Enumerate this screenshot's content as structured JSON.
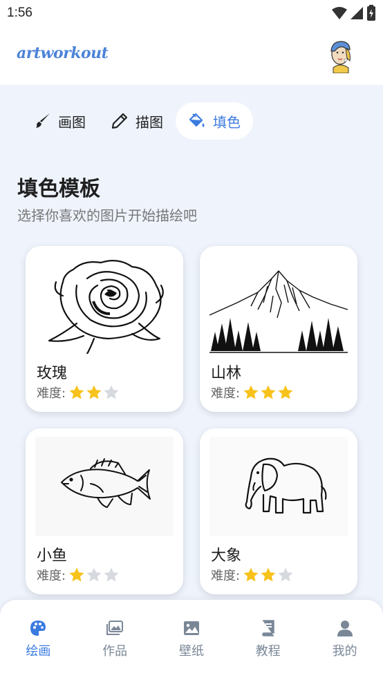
{
  "status_bar": {
    "time": "1:56"
  },
  "header": {
    "logo": "artworkout"
  },
  "mode_tabs": [
    {
      "label": "画图",
      "icon": "paintbrush-icon"
    },
    {
      "label": "描图",
      "icon": "pencil-icon"
    },
    {
      "label": "填色",
      "icon": "paint-bucket-icon",
      "active": true
    }
  ],
  "section": {
    "title": "填色模板",
    "subtitle": "选择你喜欢的图片开始描绘吧"
  },
  "difficulty_label": "难度:",
  "templates": [
    {
      "name": "玫瑰",
      "image": "rose-line-drawing",
      "difficulty": 2,
      "max": 3
    },
    {
      "name": "山林",
      "image": "mountain-forest-line-drawing",
      "difficulty": 3,
      "max": 3
    },
    {
      "name": "小鱼",
      "image": "fish-line-drawing",
      "difficulty": 1,
      "max": 3
    },
    {
      "name": "大象",
      "image": "elephant-line-drawing",
      "difficulty": 2,
      "max": 3
    }
  ],
  "bottom_nav": [
    {
      "label": "绘画",
      "icon": "palette-icon",
      "active": true
    },
    {
      "label": "作品",
      "icon": "gallery-icon"
    },
    {
      "label": "壁纸",
      "icon": "image-icon"
    },
    {
      "label": "教程",
      "icon": "book-icon"
    },
    {
      "label": "我的",
      "icon": "person-icon"
    }
  ],
  "colors": {
    "accent": "#3b7be0",
    "star_on": "#f7c21b",
    "star_off": "#d6d9de",
    "background": "#eef3fc"
  }
}
